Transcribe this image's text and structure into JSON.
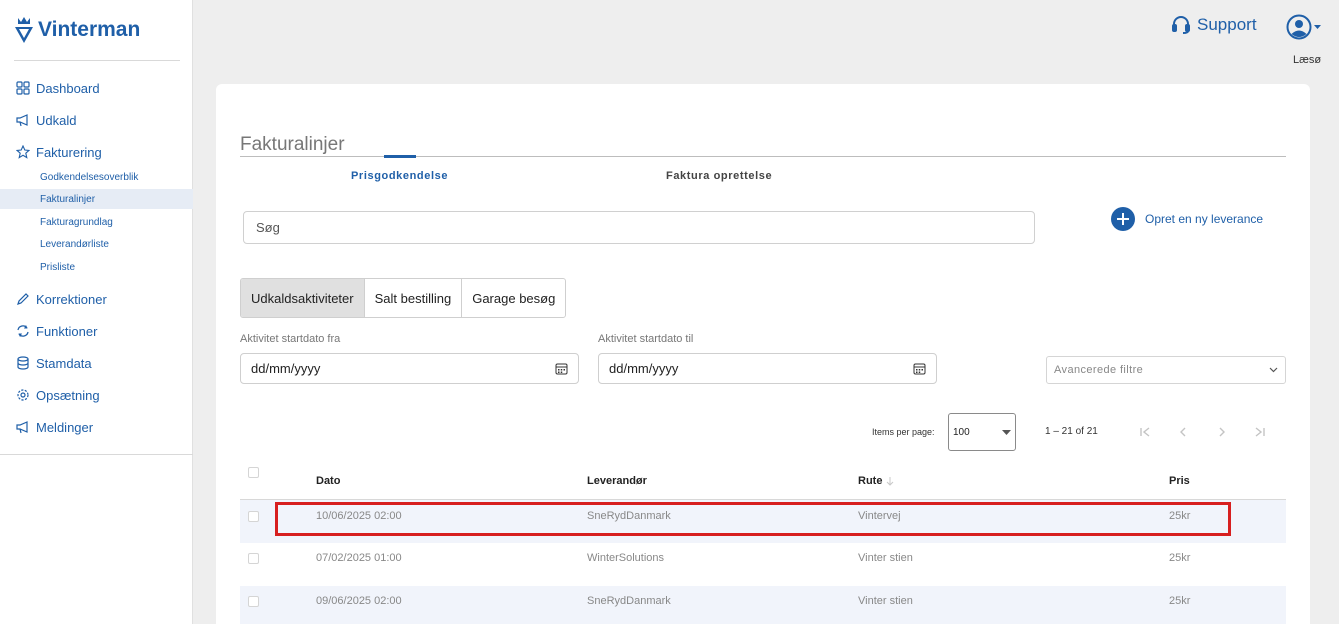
{
  "brand": {
    "name": "Vinterman",
    "color": "#1f5fa8"
  },
  "sidebar": {
    "items": [
      {
        "label": "Dashboard",
        "icon": "grid-icon"
      },
      {
        "label": "Udkald",
        "icon": "megaphone-icon"
      },
      {
        "label": "Fakturering",
        "icon": "star-icon"
      },
      {
        "label": "Korrektioner",
        "icon": "pencil-icon"
      },
      {
        "label": "Funktioner",
        "icon": "refresh-icon"
      },
      {
        "label": "Stamdata",
        "icon": "database-icon"
      },
      {
        "label": "Opsætning",
        "icon": "gear-icon"
      },
      {
        "label": "Meldinger",
        "icon": "megaphone-icon"
      }
    ],
    "subitems": [
      {
        "label": "Godkendelsesoverblik",
        "active": false
      },
      {
        "label": "Fakturalinjer",
        "active": true
      },
      {
        "label": "Fakturagrundlag",
        "active": false
      },
      {
        "label": "Leverandørliste",
        "active": false
      },
      {
        "label": "Prisliste",
        "active": false
      }
    ]
  },
  "header": {
    "support_label": "Support",
    "user_name": "Læsø"
  },
  "main": {
    "title": "Fakturalinjer",
    "tabs": [
      {
        "label": "Prisgodkendelse",
        "active": true
      },
      {
        "label": "Faktura oprettelse",
        "active": false
      }
    ],
    "search_placeholder": "Søg",
    "new_delivery_label": "Opret en ny leverance",
    "segments": [
      {
        "label": "Udkaldsaktiviteter",
        "active": true
      },
      {
        "label": "Salt bestilling",
        "active": false
      },
      {
        "label": "Garage besøg",
        "active": false
      }
    ],
    "date_from": {
      "label": "Aktivitet startdato fra",
      "value": "dd/mm/yyyy"
    },
    "date_to": {
      "label": "Aktivitet startdato til",
      "value": "dd/mm/yyyy"
    },
    "advanced_filters_label": "Avancerede filtre",
    "paginator": {
      "items_per_page_label": "Items per page:",
      "page_size": "100",
      "range_label": "1 – 21 of 21"
    },
    "table": {
      "columns": [
        "Dato",
        "Leverandør",
        "Rute",
        "Pris"
      ],
      "rows": [
        {
          "dato": "10/06/2025 02:00",
          "leverandor": "SneRydDanmark",
          "rute": "Vintervej",
          "pris": "25kr",
          "highlighted": true
        },
        {
          "dato": "07/02/2025 01:00",
          "leverandor": "WinterSolutions",
          "rute": "Vinter stien",
          "pris": "25kr",
          "highlighted": false
        },
        {
          "dato": "09/06/2025 02:00",
          "leverandor": "SneRydDanmark",
          "rute": "Vinter stien",
          "pris": "25kr",
          "highlighted": false
        }
      ]
    }
  },
  "colors": {
    "highlight_border": "#d71f1f",
    "row_alt": "#f1f4fb"
  }
}
